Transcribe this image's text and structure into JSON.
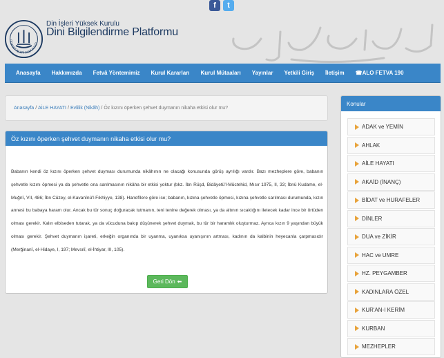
{
  "social": {
    "facebook_glyph": "f",
    "twitter_glyph": "t"
  },
  "header": {
    "org_small": "Din İşleri Yüksek Kurulu",
    "org_big": "Dini Bilgilendirme Platformu",
    "logo_ring_text": "DİYANET İŞLERİ BAŞKANLIĞI"
  },
  "nav": {
    "items": [
      "Anasayfa",
      "Hakkımızda",
      "Fetvâ Yöntemimiz",
      "Kurul Kararları",
      "Kurul Mütaaları",
      "Yayınlar",
      "Yetkili Giriş",
      "İletişim",
      "ALO FETVA 190"
    ]
  },
  "breadcrumb": {
    "items": [
      "Anasayfa",
      "AİLE HAYATI",
      "Evlilik (Nikâh)"
    ],
    "current": "Öz kızını öperken şehvet duymanın nikaha etkisi olur mu?"
  },
  "article": {
    "title": "Öz kızını öperken şehvet duymanın nikaha etkisi olur mu?",
    "body": "Babanın kendi öz kızını öperken şehvet duyması durumunda nikâhının ne olacağı konusunda görüş ayrılığı vardır. Bazı mezheplere göre, babanın şehvetle kızını öpmesi ya da şehvetle ona sarılmasının nikâha bir etkisi yoktur (bkz. İbn Rüşd, Bidâyetü'l-Müctehid, Mısır 1975, II, 33; İbnü Kudame, el-Muğnî, VII, 486; İbn Cüzey, el-Kavanînü'l-Fıkhiyye, 138). Hanefîlere göre ise; babanın, kızına şehvetle öpmesi, kızına şehvetle sarılması durumunda, kızın annesi bu babaya haram olur. Ancak bu tür sonuç doğuracak tutmanın, teni tenine değerek olması, ya da altının sıcaklığını iletecek kadar ince bir örtüden olması gerekir. Kalın elbiseden tutarak, ya da vücuduna bakıp düşünerek şehvet duymak, bu tür bir haramlık oluşturmaz. Ayrıca kızın 9 yaşından büyük olması gerekir. Şehvet duymanın işareti, erkeğin organında bir uyanma, uyanıksa uyanışının artması, kadının da kalbinin heyecanla çarpmasıdır (Merğinanî, el-Hidaye, I, 197; Mevsılî, el-İhtiyar, III, 105).",
    "back_label": "Geri Dön"
  },
  "sidebar": {
    "title": "Konular",
    "topics": [
      "ADAK ve YEMİN",
      "AHLAK",
      "AİLE HAYATI",
      "AKAİD (İNANÇ)",
      "BİDAT ve HURAFELER",
      "DİNLER",
      "DUA ve ZİKİR",
      "HAC ve UMRE",
      "HZ. PEYGAMBER",
      "KADINLARA ÖZEL",
      "KUR'AN-I KERİM",
      "KURBAN",
      "MEZHEPLER"
    ]
  },
  "colors": {
    "accent": "#3a86c8",
    "button_green": "#5cb85c",
    "arrow": "#e8a33c",
    "background": "#e5e5e5"
  }
}
